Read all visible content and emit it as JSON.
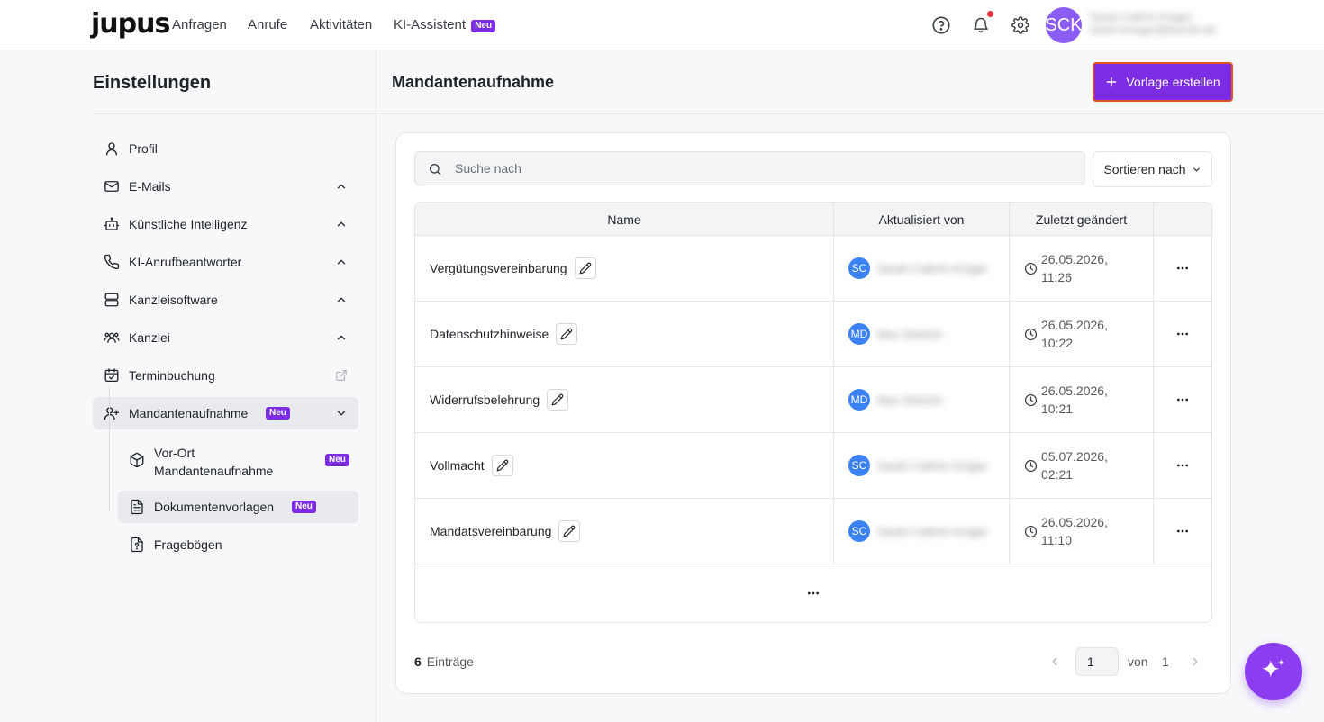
{
  "topnav": {
    "logo": "jupus",
    "links": [
      "Anfragen",
      "Anrufe",
      "Aktivitäten",
      "KI-Assistent"
    ],
    "new_badge": "Neu",
    "avatar_initials": "SCK",
    "user_line1": "Sarah Cathrin Krüger",
    "user_line2": "sarah.krueger@kanzlei.de"
  },
  "sidebar": {
    "title": "Einstellungen",
    "items": [
      {
        "label": "Profil",
        "icon": "user-icon"
      },
      {
        "label": "E-Mails",
        "icon": "mail-icon"
      },
      {
        "label": "Künstliche Intelligenz",
        "icon": "bot-icon"
      },
      {
        "label": "KI-Anrufbeantworter",
        "icon": "phone-icon"
      },
      {
        "label": "Kanzleisoftware",
        "icon": "server-icon"
      },
      {
        "label": "Kanzlei",
        "icon": "users-icon"
      },
      {
        "label": "Terminbuchung",
        "icon": "calendar-check-icon"
      },
      {
        "label": "Mandantenaufnahme",
        "icon": "user-plus-icon",
        "badge": "Neu"
      }
    ],
    "subitems": [
      {
        "label": "Vor-Ort Mandantenaufnahme",
        "icon": "package-icon",
        "badge": "Neu"
      },
      {
        "label": "Dokumentenvorlagen",
        "icon": "file-text-icon",
        "badge": "Neu"
      },
      {
        "label": "Fragebögen",
        "icon": "file-question-icon"
      }
    ]
  },
  "main": {
    "title": "Mandantenaufnahme",
    "create_button": "Vorlage erstellen",
    "search_placeholder": "Suche nach",
    "sort_label": "Sortieren nach",
    "columns": [
      "Name",
      "Aktualisiert von",
      "Zuletzt geändert"
    ],
    "rows": [
      {
        "name": "Vergütungsvereinbarung",
        "initials": "SC",
        "user": "Sarah Cathrin Krüger",
        "date": "26.05.2026,",
        "time": "11:26"
      },
      {
        "name": "Datenschutzhinweise",
        "initials": "MD",
        "user": "Max Dietrich",
        "date": "26.05.2026,",
        "time": "10:22"
      },
      {
        "name": "Widerrufsbelehrung",
        "initials": "MD",
        "user": "Max Dietrich",
        "date": "26.05.2026,",
        "time": "10:21"
      },
      {
        "name": "Vollmacht",
        "initials": "SC",
        "user": "Sarah Cathrin Krüger",
        "date": "05.07.2026,",
        "time": "02:21"
      },
      {
        "name": "Mandatsvereinbarung",
        "initials": "SC",
        "user": "Sarah Cathrin Krüger",
        "date": "26.05.2026,",
        "time": "11:10"
      }
    ],
    "footer": {
      "count": "6",
      "count_label": "Einträge",
      "page": "1",
      "of_label": "von",
      "total_pages": "1"
    }
  },
  "colors": {
    "brand": "#7c2de3",
    "highlight_border": "#e0541f",
    "avatar_blue": "#3b82f6",
    "avatar_purple": "#8b5cf6"
  }
}
